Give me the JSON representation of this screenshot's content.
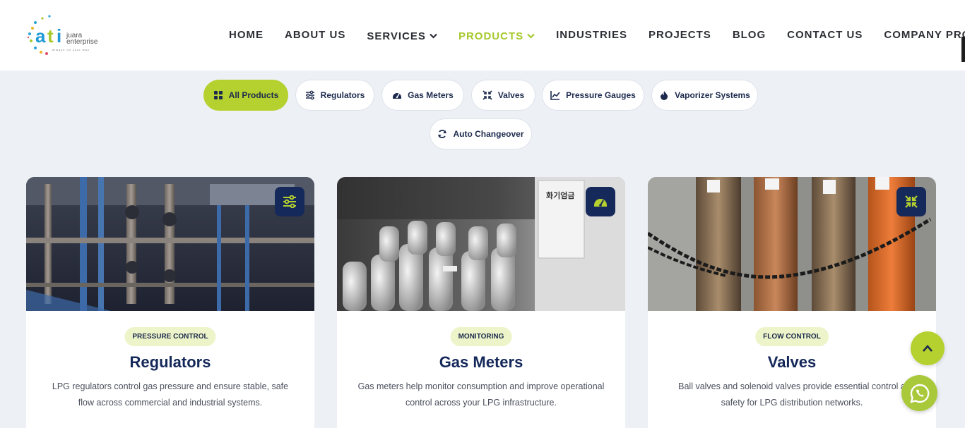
{
  "brand": {
    "logo_mark": "ati",
    "logo_line1": "juara",
    "logo_line2": "enterprise",
    "logo_tagline": "always on your way"
  },
  "nav": {
    "home": "HOME",
    "about": "ABOUT US",
    "services": "SERVICES",
    "products": "PRODUCTS",
    "industries": "INDUSTRIES",
    "projects": "PROJECTS",
    "blog": "BLOG",
    "contact": "CONTACT US",
    "profile": "COMPANY PROFILE"
  },
  "filters": {
    "all": "All Products",
    "regulators": "Regulators",
    "gas_meters": "Gas Meters",
    "valves": "Valves",
    "pressure_gauges": "Pressure Gauges",
    "vaporizer": "Vaporizer Systems",
    "changeover": "Auto Changeover",
    "active": "All Products"
  },
  "cards": [
    {
      "tag": "PRESSURE CONTROL",
      "title": "Regulators",
      "desc": "LPG regulators control gas pressure and ensure stable, safe flow across commercial and industrial systems.",
      "icon": "sliders-icon"
    },
    {
      "tag": "MONITORING",
      "title": "Gas Meters",
      "desc": "Gas meters help monitor consumption and improve operational control across your LPG infrastructure.",
      "icon": "gauge-icon"
    },
    {
      "tag": "FLOW CONTROL",
      "title": "Valves",
      "desc": "Ball valves and solenoid valves provide essential control a safety for LPG distribution networks.",
      "icon": "compress-icon"
    }
  ],
  "colors": {
    "accent": "#b5d12f",
    "navy": "#15295a",
    "nav_text": "#2d2f36",
    "active_nav": "#a6c92c",
    "background": "#edf0f5"
  }
}
